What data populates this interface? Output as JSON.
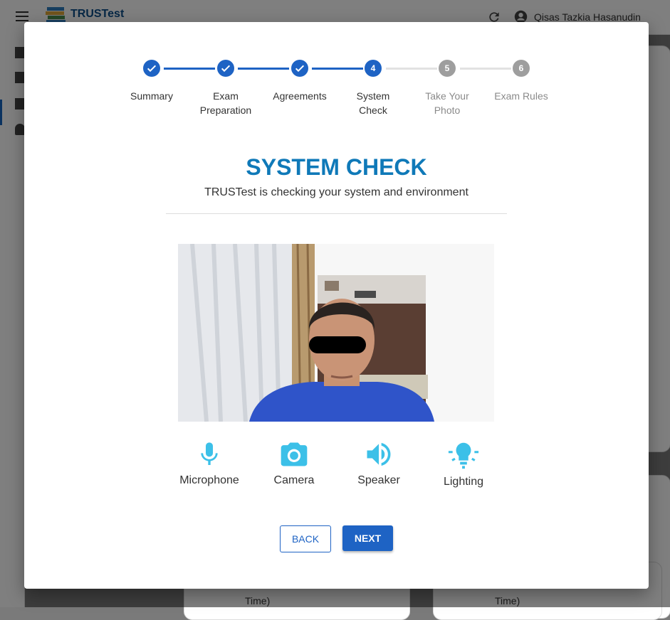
{
  "app": {
    "brand": "TRUSTest",
    "user_name": "Qisas Tazkia Hasanudin",
    "background_text": [
      "Time)",
      "Time)"
    ]
  },
  "stepper": {
    "steps": [
      {
        "number": "1",
        "label_line1": "Summary",
        "label_line2": "",
        "state": "done"
      },
      {
        "number": "2",
        "label_line1": "Exam",
        "label_line2": "Preparation",
        "state": "done"
      },
      {
        "number": "3",
        "label_line1": "Agreements",
        "label_line2": "",
        "state": "done"
      },
      {
        "number": "4",
        "label_line1": "System",
        "label_line2": "Check",
        "state": "active"
      },
      {
        "number": "5",
        "label_line1": "Take Your",
        "label_line2": "Photo",
        "state": "pending"
      },
      {
        "number": "6",
        "label_line1": "Exam Rules",
        "label_line2": "",
        "state": "pending"
      }
    ]
  },
  "main": {
    "title": "SYSTEM CHECK",
    "subtitle": "TRUSTest is checking your system and environment"
  },
  "checks": [
    {
      "label": "Microphone",
      "icon": "microphone-icon"
    },
    {
      "label": "Camera",
      "icon": "camera-icon"
    },
    {
      "label": "Speaker",
      "icon": "speaker-icon"
    },
    {
      "label": "Lighting",
      "icon": "lightbulb-icon"
    }
  ],
  "buttons": {
    "back": "BACK",
    "next": "NEXT"
  },
  "colors": {
    "primary": "#1e63c4",
    "title": "#0f79b8",
    "check_icon": "#3cc0e8",
    "pending": "#9e9e9e"
  }
}
